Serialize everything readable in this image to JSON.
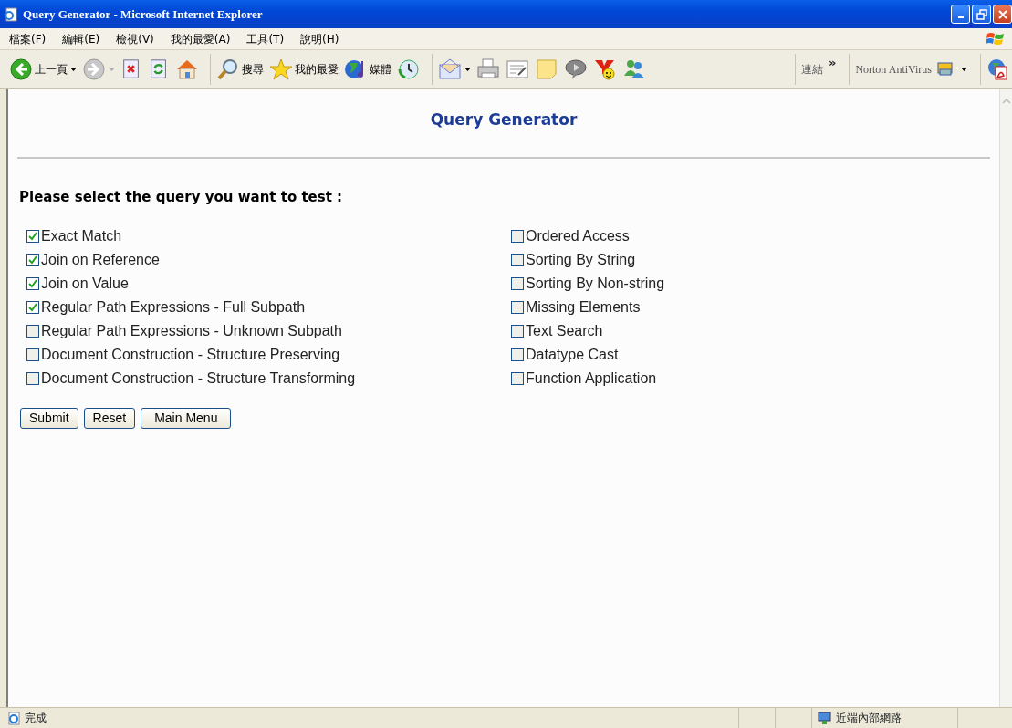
{
  "window": {
    "title": "Query Generator - Microsoft Internet Explorer"
  },
  "menu": [
    "檔案(F)",
    "編輯(E)",
    "檢視(V)",
    "我的最愛(A)",
    "工具(T)",
    "說明(H)"
  ],
  "toolbar": [
    {
      "kind": "back",
      "label": "上一頁",
      "dropdown": true
    },
    {
      "kind": "forward",
      "dropdown": true
    },
    {
      "kind": "stop"
    },
    {
      "kind": "refresh"
    },
    {
      "kind": "home"
    },
    {
      "kind": "separator"
    },
    {
      "kind": "search",
      "label": "搜尋"
    },
    {
      "kind": "favorites",
      "label": "我的最愛"
    },
    {
      "kind": "media",
      "label": "媒體"
    },
    {
      "kind": "history"
    },
    {
      "kind": "separator"
    },
    {
      "kind": "mail",
      "dropdown": true
    },
    {
      "kind": "print"
    },
    {
      "kind": "edit"
    },
    {
      "kind": "note"
    },
    {
      "kind": "discuss"
    },
    {
      "kind": "yahoo"
    },
    {
      "kind": "messenger"
    }
  ],
  "links_label": "連結",
  "links_chevron": "»",
  "norton_label": "Norton AntiVirus",
  "page": {
    "heading": "Query Generator",
    "prompt": "Please select the query you want to test :",
    "left_options": [
      {
        "label": "Exact Match",
        "checked": true
      },
      {
        "label": "Join on Reference",
        "checked": true
      },
      {
        "label": "Join on Value",
        "checked": true
      },
      {
        "label": "Regular Path Expressions - Full Subpath",
        "checked": true
      },
      {
        "label": "Regular Path Expressions - Unknown Subpath",
        "checked": false
      },
      {
        "label": "Document Construction - Structure Preserving",
        "checked": false
      },
      {
        "label": "Document Construction - Structure Transforming",
        "checked": false
      }
    ],
    "right_options": [
      {
        "label": "Ordered Access",
        "checked": false
      },
      {
        "label": "Sorting By String",
        "checked": false
      },
      {
        "label": "Sorting By Non-string",
        "checked": false
      },
      {
        "label": "Missing Elements",
        "checked": false
      },
      {
        "label": "Text Search",
        "checked": false
      },
      {
        "label": "Datatype Cast",
        "checked": false
      },
      {
        "label": "Function Application",
        "checked": false
      }
    ],
    "buttons": [
      "Submit",
      "Reset",
      "Main Menu"
    ]
  },
  "status_bar": {
    "text": "完成",
    "zone": "近端內部網路"
  }
}
